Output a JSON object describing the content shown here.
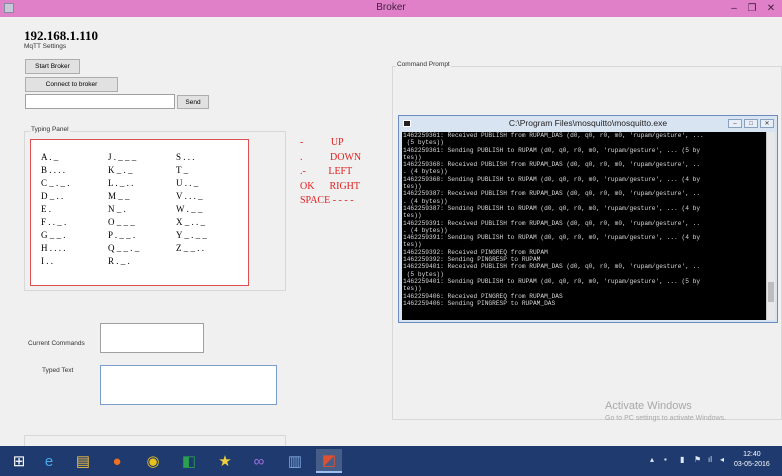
{
  "window": {
    "title": "Broker",
    "min_glyph": "–",
    "max_glyph": "❐",
    "close_glyph": "✕"
  },
  "broker": {
    "ip": "192.168.1.110"
  },
  "mqtt_settings": {
    "label": "MqTT Settings",
    "start_label": "Start Broker",
    "connect_label": "Connect to broker",
    "message_value": "",
    "send_label": "Send"
  },
  "typing_panel": {
    "label": "Typing Panel",
    "columns": [
      [
        "A . _",
        "B . . . .",
        "C _ . _ .",
        "D _ . .",
        "E .",
        "F . . _ .",
        "G _ _ .",
        "H . . . .",
        "I . ."
      ],
      [
        "J . _ _ _",
        "K _ . _",
        "L . _ . .",
        "M _ _",
        "N _ .",
        "O _ _ _",
        "P . _ _ .",
        "Q _ _ . _",
        "R . _ ."
      ],
      [
        "S . . .",
        "T _",
        "U . . _",
        "V . . . _",
        "W . _ _",
        "X _ . . _",
        "Y _ . _ _",
        "Z _ _ . ."
      ]
    ]
  },
  "legend": {
    "line1": "-           UP",
    "line2": ".           DOWN",
    "line3": ".-         LEFT",
    "line4": "OK      RIGHT",
    "line5": "SPACE - - - -"
  },
  "commands": {
    "current_label": "Current Commands",
    "current_value": "",
    "typed_label": "Typed Text",
    "typed_value": ""
  },
  "command_prompt": {
    "label": "Command Prompt",
    "title": "C:\\Program Files\\mosquitto\\mosquitto.exe",
    "lines": [
      "1462259361: Received PUBLISH from RUPAM_DAS (d0, q0, r0, m0, 'rupam/gesture', ...",
      " (5 bytes))",
      "1462259361: Sending PUBLISH to RUPAM (d0, q0, r0, m0, 'rupam/gesture', ... (5 by",
      "tes))",
      "1462259368: Received PUBLISH from RUPAM_DAS (d0, q0, r0, m0, 'rupam/gesture', ..",
      ". (4 bytes))",
      "1462259368: Sending PUBLISH to RUPAM (d0, q0, r0, m0, 'rupam/gesture', ... (4 by",
      "tes))",
      "1462259387: Received PUBLISH from RUPAM_DAS (d0, q0, r0, m0, 'rupam/gesture', ..",
      ". (4 bytes))",
      "1462259387: Sending PUBLISH to RUPAM (d0, q0, r0, m0, 'rupam/gesture', ... (4 by",
      "tes))",
      "1462259391: Received PUBLISH from RUPAM_DAS (d0, q0, r0, m0, 'rupam/gesture', ..",
      ". (4 bytes))",
      "1462259391: Sending PUBLISH to RUPAM (d0, q0, r0, m0, 'rupam/gesture', ... (4 by",
      "tes))",
      "1462259392: Received PINGREQ from RUPAM",
      "1462259392: Sending PINGRESP to RUPAM",
      "1462259401: Received PUBLISH from RUPAM_DAS (d0, q0, r0, m0, 'rupam/gesture', ..",
      " (5 bytes))",
      "1462259401: Sending PUBLISH to RUPAM (d0, q0, r0, m0, 'rupam/gesture', ... (5 by",
      "tes))",
      "1462259406: Received PINGREQ from RUPAM_DAS",
      "1462259406: Sending PINGRESP to RUPAM_DAS"
    ]
  },
  "watermark": {
    "line1": "Activate Windows",
    "line2": "Go to PC settings to activate Windows."
  },
  "taskbar": {
    "items": [
      {
        "icon": "windows-start-icon",
        "glyph": "⊞",
        "color": "#ffffff"
      },
      {
        "icon": "internet-explorer-icon",
        "glyph": "e",
        "color": "#4aa8ec"
      },
      {
        "icon": "file-explorer-icon",
        "glyph": "▤",
        "color": "#f0c040"
      },
      {
        "icon": "firefox-icon",
        "glyph": "●",
        "color": "#f07020"
      },
      {
        "icon": "chrome-icon",
        "glyph": "◉",
        "color": "#e8c020"
      },
      {
        "icon": "green-app-icon",
        "glyph": "◧",
        "color": "#2aa050"
      },
      {
        "icon": "media-app-icon",
        "glyph": "★",
        "color": "#f0d040"
      },
      {
        "icon": "visual-studio-icon",
        "glyph": "∞",
        "color": "#a070e0"
      },
      {
        "icon": "document-app-icon",
        "glyph": "▥",
        "color": "#80a8e0"
      },
      {
        "icon": "broker-app-icon",
        "glyph": "◩",
        "color": "#e05030"
      }
    ],
    "time": "12:40",
    "date": "03-05-2016"
  }
}
